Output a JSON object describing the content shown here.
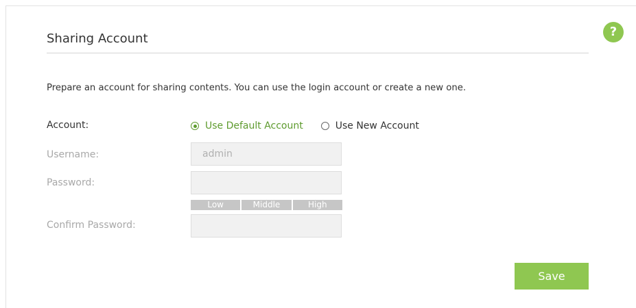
{
  "section": {
    "title": "Sharing Account",
    "description": "Prepare an account for sharing contents. You can use the login account or create a new one."
  },
  "help": {
    "label": "?"
  },
  "form": {
    "account_label": "Account:",
    "account_options": [
      {
        "label": "Use Default Account",
        "checked": true
      },
      {
        "label": "Use New Account",
        "checked": false
      }
    ],
    "username_label": "Username:",
    "username_value": "admin",
    "password_label": "Password:",
    "password_value": "",
    "strength_levels": [
      "Low",
      "Middle",
      "High"
    ],
    "confirm_password_label": "Confirm Password:",
    "confirm_password_value": ""
  },
  "actions": {
    "save_label": "Save"
  },
  "colors": {
    "accent": "#8fc751",
    "checked_text": "#5e9b2e",
    "disabled_text": "#a8a8a8",
    "field_bg": "#f1f1f1"
  }
}
